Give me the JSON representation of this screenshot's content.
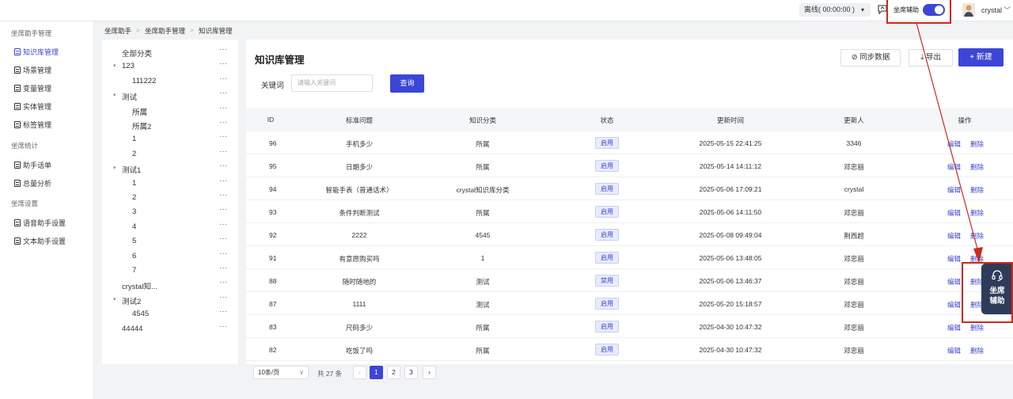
{
  "header": {
    "status": "离线( 00:00:00 )",
    "assist_label": "坐席辅助",
    "user_name": "crystal"
  },
  "sidebar": {
    "groups": [
      {
        "label": "坐席助手管理",
        "items": [
          "知识库管理",
          "场景管理",
          "变量管理",
          "实体管理",
          "标签管理"
        ]
      },
      {
        "label": "坐席统计",
        "items": [
          "助手话单",
          "总量分析"
        ]
      },
      {
        "label": "坐席设置",
        "items": [
          "语音助手设置",
          "文本助手设置"
        ]
      }
    ]
  },
  "breadcrumb": [
    "坐席助手",
    "坐席助手管理",
    "知识库管理"
  ],
  "tree": [
    {
      "label": "全部分类",
      "level": 0,
      "expanded": null
    },
    {
      "label": "123",
      "level": 0,
      "expanded": true
    },
    {
      "label": "111222",
      "level": 1,
      "expanded": null
    },
    {
      "label": "测试",
      "level": 0,
      "expanded": true
    },
    {
      "label": "所属",
      "level": 1,
      "expanded": null
    },
    {
      "label": "所属2",
      "level": 1,
      "expanded": null
    },
    {
      "label": "1",
      "level": 1,
      "expanded": null
    },
    {
      "label": "2",
      "level": 1,
      "expanded": null
    },
    {
      "label": "测试1",
      "level": 0,
      "expanded": true
    },
    {
      "label": "1",
      "level": 1,
      "expanded": null
    },
    {
      "label": "2",
      "level": 1,
      "expanded": null
    },
    {
      "label": "3",
      "level": 1,
      "expanded": null
    },
    {
      "label": "4",
      "level": 1,
      "expanded": null
    },
    {
      "label": "5",
      "level": 1,
      "expanded": null
    },
    {
      "label": "6",
      "level": 1,
      "expanded": null
    },
    {
      "label": "7",
      "level": 1,
      "expanded": null
    },
    {
      "label": "crystal知...",
      "level": 0,
      "expanded": null
    },
    {
      "label": "测试2",
      "level": 0,
      "expanded": true
    },
    {
      "label": "4545",
      "level": 1,
      "expanded": null
    },
    {
      "label": "44444",
      "level": 0,
      "expanded": null
    }
  ],
  "main": {
    "title": "知识库管理",
    "keyword_label": "关键词",
    "keyword_placeholder": "请输入关键词",
    "query_label": "查询",
    "sync_label": "同步数据",
    "export_label": "导出",
    "new_label": "+ 新建"
  },
  "table": {
    "columns": [
      "ID",
      "标准问题",
      "知识分类",
      "状态",
      "更新时间",
      "更新人",
      "操作"
    ],
    "rows": [
      {
        "id": "96",
        "question": "手机多少",
        "category": "所属",
        "status": "启用",
        "time": "2025-05-15 22:41:25",
        "user": "3346"
      },
      {
        "id": "95",
        "question": "日期多少",
        "category": "所属",
        "status": "启用",
        "time": "2025-05-14 14:11:12",
        "user": "邓忠丽"
      },
      {
        "id": "94",
        "question": "智能手表（普通话术）",
        "category": "crystal知识库分类",
        "status": "启用",
        "time": "2025-05-06 17:09:21",
        "user": "crystal"
      },
      {
        "id": "93",
        "question": "条件判断测试",
        "category": "所属",
        "status": "启用",
        "time": "2025-05-06 14:11:50",
        "user": "邓忠丽"
      },
      {
        "id": "92",
        "question": "2222",
        "category": "4545",
        "status": "启用",
        "time": "2025-05-08 09:49:04",
        "user": "荆西超"
      },
      {
        "id": "91",
        "question": "有意愿购买吗",
        "category": "1",
        "status": "启用",
        "time": "2025-05-06 13:48:05",
        "user": "邓忠丽"
      },
      {
        "id": "88",
        "question": "随时随地的",
        "category": "测试",
        "status": "禁用",
        "time": "2025-05-06 13:46:37",
        "user": "邓忠丽"
      },
      {
        "id": "87",
        "question": "1111",
        "category": "测试",
        "status": "启用",
        "time": "2025-05-20 15:18:57",
        "user": "邓忠丽"
      },
      {
        "id": "83",
        "question": "尺码多少",
        "category": "所属",
        "status": "启用",
        "time": "2025-04-30 10:47:32",
        "user": "邓忠丽"
      },
      {
        "id": "82",
        "question": "吃饭了吗",
        "category": "所属",
        "status": "启用",
        "time": "2025-04-30 10:47:32",
        "user": "邓忠丽"
      }
    ],
    "edit_label": "编辑",
    "delete_label": "删除"
  },
  "pagination": {
    "page_size": "10条/页",
    "total": "共 27 条",
    "pages": [
      "1",
      "2",
      "3"
    ],
    "current": "1"
  },
  "float_assist": {
    "label": "坐席辅助"
  },
  "colors": {
    "primary": "#3b46d6",
    "annotation_red": "#d0281e",
    "float_bg": "#2e3c5a"
  }
}
